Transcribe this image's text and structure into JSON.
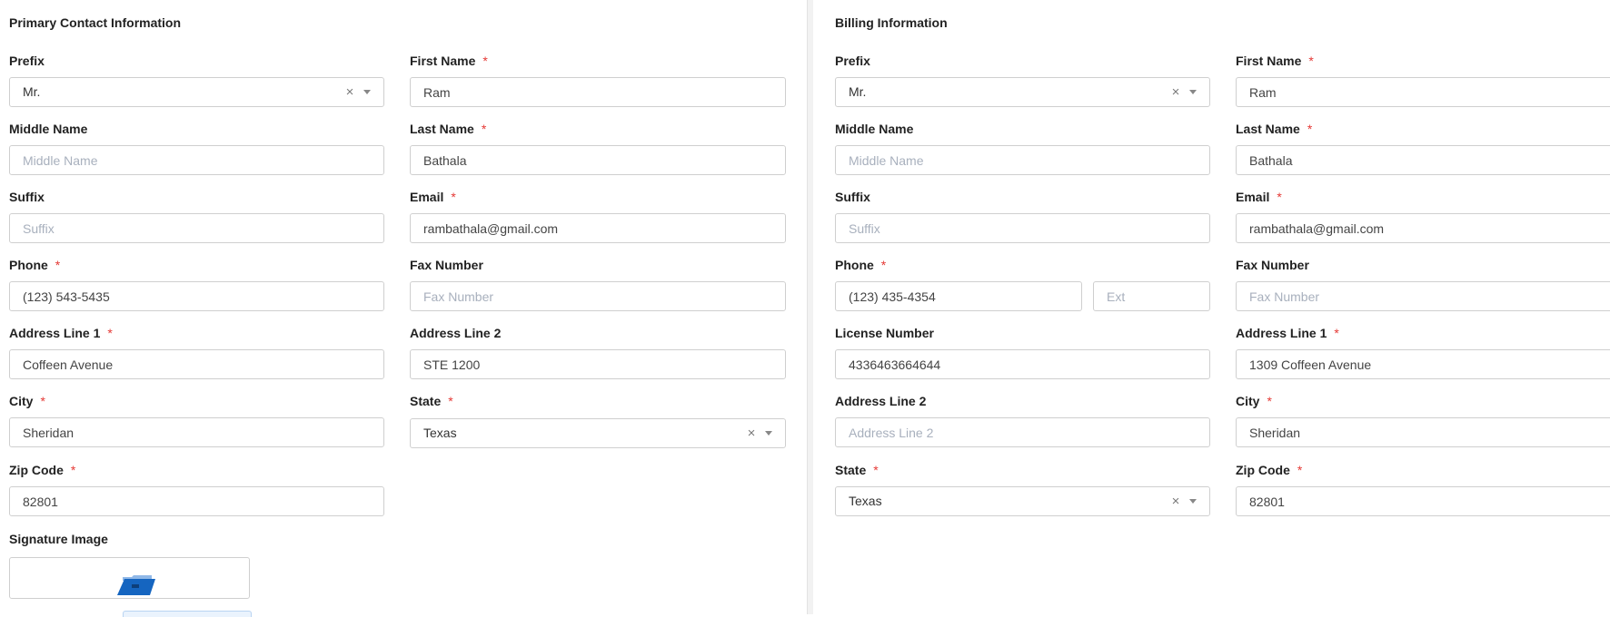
{
  "primary": {
    "title": "Primary Contact Information",
    "prefix": {
      "label": "Prefix",
      "value": "Mr."
    },
    "first_name": {
      "label": "First Name",
      "value": "Ram"
    },
    "middle_name": {
      "label": "Middle Name",
      "placeholder": "Middle Name"
    },
    "last_name": {
      "label": "Last Name",
      "value": "Bathala"
    },
    "suffix": {
      "label": "Suffix",
      "placeholder": "Suffix"
    },
    "email": {
      "label": "Email",
      "value": "rambathala@gmail.com"
    },
    "phone": {
      "label": "Phone",
      "value": "(123) 543-5435"
    },
    "fax": {
      "label": "Fax Number",
      "placeholder": "Fax Number"
    },
    "address1": {
      "label": "Address Line 1",
      "value": "Coffeen Avenue"
    },
    "address2": {
      "label": "Address Line 2",
      "value": "STE 1200"
    },
    "city": {
      "label": "City",
      "value": "Sheridan"
    },
    "state": {
      "label": "State",
      "value": "Texas"
    },
    "zip": {
      "label": "Zip Code",
      "value": "82801"
    },
    "signature": {
      "label": "Signature Image"
    }
  },
  "billing": {
    "title": "Billing Information",
    "prefix": {
      "label": "Prefix",
      "value": "Mr."
    },
    "first_name": {
      "label": "First Name",
      "value": "Ram"
    },
    "middle_name": {
      "label": "Middle Name",
      "placeholder": "Middle Name"
    },
    "last_name": {
      "label": "Last Name",
      "value": "Bathala"
    },
    "suffix": {
      "label": "Suffix",
      "placeholder": "Suffix"
    },
    "email": {
      "label": "Email",
      "value": "rambathala@gmail.com"
    },
    "phone": {
      "label": "Phone",
      "value": "(123) 435-4354",
      "ext_placeholder": "Ext"
    },
    "fax": {
      "label": "Fax Number",
      "placeholder": "Fax Number"
    },
    "license": {
      "label": "License Number",
      "value": "4336463664644"
    },
    "address1": {
      "label": "Address Line 1",
      "value": "1309 Coffeen Avenue"
    },
    "address2": {
      "label": "Address Line 2",
      "placeholder": "Address Line 2"
    },
    "city": {
      "label": "City",
      "value": "Sheridan"
    },
    "state": {
      "label": "State",
      "value": "Texas"
    },
    "zip": {
      "label": "Zip Code",
      "value": "82801"
    }
  },
  "ui": {
    "required_mark": "*",
    "clear_glyph": "×",
    "required_color": "#e53935",
    "folder_color": "#1565c0"
  }
}
